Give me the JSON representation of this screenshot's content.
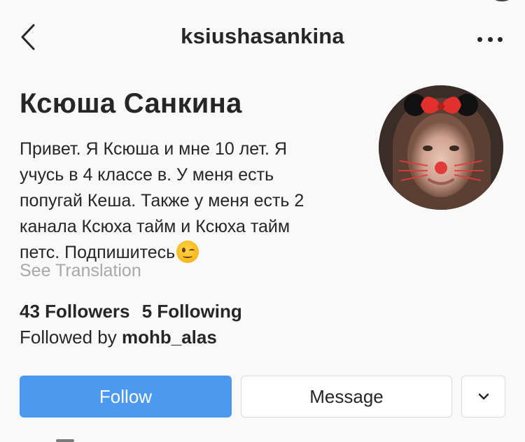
{
  "header": {
    "username": "ksiushasankina",
    "back_icon": "chevron-left-icon",
    "more_icon": "more-horizontal-icon"
  },
  "profile": {
    "full_name": "Ксюша Санкина",
    "bio_lines": [
      "Привет. Я Ксюша и мне 10 лет. Я",
      "учусь в 4 классе в. У меня есть",
      "попугай Кеша. Также у меня есть 2",
      "канала Ксюха тайм и Ксюха тайм",
      "петс. Подпишитесь"
    ],
    "bio_emoji": "winking-face-emoji",
    "see_translation": "See Translation",
    "followers": "43 Followers",
    "following": "5 Following",
    "followed_by_prefix": "Followed by",
    "followed_by_user": "mohb_alas"
  },
  "actions": {
    "follow_label": "Follow",
    "message_label": "Message",
    "dropdown_icon": "chevron-down-icon"
  },
  "colors": {
    "follow_button": "#4b9aef",
    "background": "#f9f9f9",
    "text": "#262626",
    "muted_text": "#a8a8a8"
  }
}
